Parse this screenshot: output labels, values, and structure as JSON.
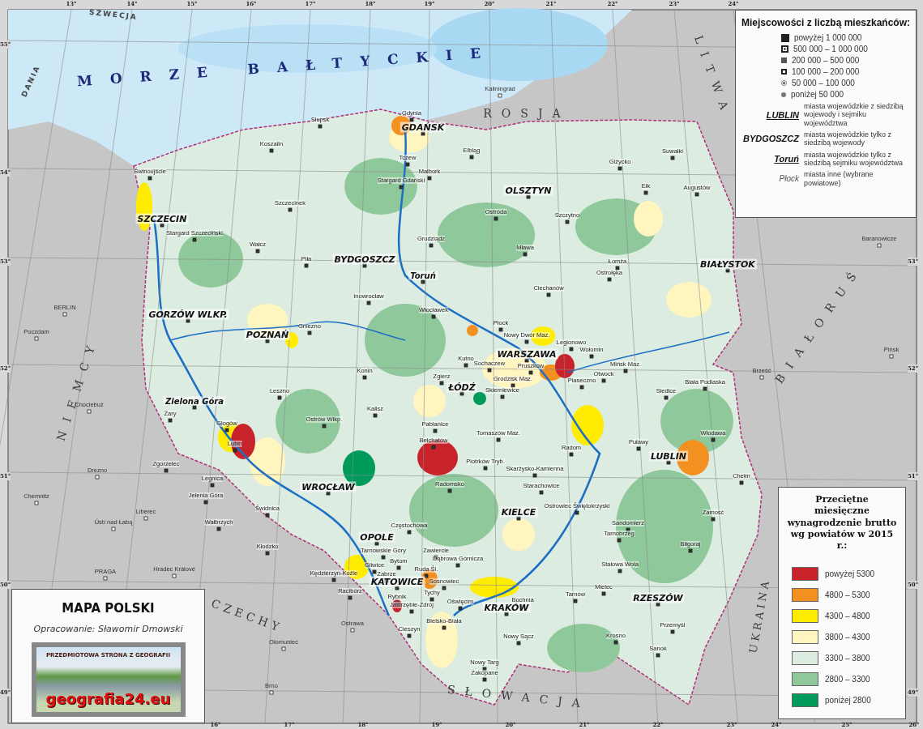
{
  "graticule": {
    "top": [
      "13°",
      "14°",
      "15°",
      "16°",
      "17°",
      "18°",
      "19°",
      "20°",
      "21°",
      "22°",
      "23°",
      "24°"
    ],
    "bottom": [
      "16°",
      "17°",
      "18°",
      "19°",
      "20°",
      "21°",
      "22°",
      "23°",
      "24°",
      "25°",
      "26°"
    ],
    "left": [
      "55°",
      "54°",
      "53°",
      "52°",
      "51°",
      "50°",
      "49°"
    ],
    "right": [
      "53°",
      "52°",
      "51°",
      "50°",
      "49°"
    ]
  },
  "places": [
    {
      "name": "MORZE BAŁTYCKIE",
      "kind": "sea"
    },
    {
      "name": "SZWECJA",
      "kind": "country-small"
    },
    {
      "name": "DANIA",
      "kind": "country-small"
    },
    {
      "name": "ROSJA",
      "kind": "country"
    },
    {
      "name": "LITWA",
      "kind": "country"
    },
    {
      "name": "BIAŁORUŚ",
      "kind": "country"
    },
    {
      "name": "UKRAINA",
      "kind": "country"
    },
    {
      "name": "NIEMCY",
      "kind": "country"
    },
    {
      "name": "CZECHY",
      "kind": "country"
    },
    {
      "name": "SŁOWACJA",
      "kind": "country"
    },
    {
      "name": "GDAŃSK",
      "kind": "capital"
    },
    {
      "name": "OLSZTYN",
      "kind": "capital"
    },
    {
      "name": "SZCZECIN",
      "kind": "capital"
    },
    {
      "name": "BYDGOSZCZ",
      "kind": "capital"
    },
    {
      "name": "BIAŁYSTOK",
      "kind": "capital"
    },
    {
      "name": "Toruń",
      "kind": "capital-sejmik"
    },
    {
      "name": "GORZÓW WLKP.",
      "kind": "capital"
    },
    {
      "name": "POZNAŃ",
      "kind": "capital"
    },
    {
      "name": "WARSZAWA",
      "kind": "capital"
    },
    {
      "name": "ŁÓDŹ",
      "kind": "capital"
    },
    {
      "name": "Zielona Góra",
      "kind": "capital-sejmik"
    },
    {
      "name": "LUBLIN",
      "kind": "capital"
    },
    {
      "name": "WROCŁAW",
      "kind": "capital"
    },
    {
      "name": "KIELCE",
      "kind": "capital"
    },
    {
      "name": "OPOLE",
      "kind": "capital"
    },
    {
      "name": "KATOWICE",
      "kind": "capital"
    },
    {
      "name": "RZESZÓW",
      "kind": "capital"
    },
    {
      "name": "KRAKÓW",
      "kind": "capital"
    },
    {
      "name": "Gdynia",
      "kind": "town"
    },
    {
      "name": "Słupsk",
      "kind": "town"
    },
    {
      "name": "Koszalin",
      "kind": "town"
    },
    {
      "name": "Kaliningrad",
      "kind": "foreign"
    },
    {
      "name": "Elbląg",
      "kind": "town"
    },
    {
      "name": "Tczew",
      "kind": "town"
    },
    {
      "name": "Malbork",
      "kind": "town"
    },
    {
      "name": "Stargard Gdański",
      "kind": "town"
    },
    {
      "name": "Świnoujście",
      "kind": "town"
    },
    {
      "name": "Stargard Szczeciński",
      "kind": "town"
    },
    {
      "name": "Szczecinek",
      "kind": "town"
    },
    {
      "name": "Wałcz",
      "kind": "town"
    },
    {
      "name": "Piła",
      "kind": "town"
    },
    {
      "name": "Grudziądz",
      "kind": "town"
    },
    {
      "name": "Ostróda",
      "kind": "town"
    },
    {
      "name": "Szczytno",
      "kind": "town"
    },
    {
      "name": "Giżycko",
      "kind": "town"
    },
    {
      "name": "Suwałki",
      "kind": "town"
    },
    {
      "name": "Ełk",
      "kind": "town"
    },
    {
      "name": "Augustów",
      "kind": "town"
    },
    {
      "name": "Mława",
      "kind": "town"
    },
    {
      "name": "Łomża",
      "kind": "town"
    },
    {
      "name": "Ostrołęka",
      "kind": "town"
    },
    {
      "name": "Ciechanów",
      "kind": "town"
    },
    {
      "name": "Inowrocław",
      "kind": "town"
    },
    {
      "name": "Gniezno",
      "kind": "town"
    },
    {
      "name": "Włocławek",
      "kind": "town"
    },
    {
      "name": "Płock",
      "kind": "town"
    },
    {
      "name": "Kutno",
      "kind": "town"
    },
    {
      "name": "Nowy Dwór Maz.",
      "kind": "town"
    },
    {
      "name": "Legionowo",
      "kind": "town"
    },
    {
      "name": "Wołomin",
      "kind": "town"
    },
    {
      "name": "Mińsk Maz.",
      "kind": "town"
    },
    {
      "name": "Siedlce",
      "kind": "town"
    },
    {
      "name": "Biała Podlaska",
      "kind": "town"
    },
    {
      "name": "Konin",
      "kind": "town"
    },
    {
      "name": "Leszno",
      "kind": "town"
    },
    {
      "name": "Kalisz",
      "kind": "town"
    },
    {
      "name": "Ostrów Wlkp.",
      "kind": "town"
    },
    {
      "name": "Zgierz",
      "kind": "town"
    },
    {
      "name": "Pabianice",
      "kind": "town"
    },
    {
      "name": "Bełchatów",
      "kind": "town"
    },
    {
      "name": "Sochaczew",
      "kind": "town"
    },
    {
      "name": "Skierniewice",
      "kind": "town"
    },
    {
      "name": "Pruszków",
      "kind": "town"
    },
    {
      "name": "Grodzisk Maz.",
      "kind": "town"
    },
    {
      "name": "Piaseczno",
      "kind": "town"
    },
    {
      "name": "Otwock",
      "kind": "town"
    },
    {
      "name": "Tomaszów Maz.",
      "kind": "town"
    },
    {
      "name": "Piotrków Tryb.",
      "kind": "town"
    },
    {
      "name": "Radom",
      "kind": "town"
    },
    {
      "name": "Puławy",
      "kind": "town"
    },
    {
      "name": "Włodawa",
      "kind": "town"
    },
    {
      "name": "Chełm",
      "kind": "town"
    },
    {
      "name": "Zamość",
      "kind": "town"
    },
    {
      "name": "Radomsko",
      "kind": "town"
    },
    {
      "name": "Częstochowa",
      "kind": "town"
    },
    {
      "name": "Skarżysko-Kamienna",
      "kind": "town"
    },
    {
      "name": "Starachowice",
      "kind": "town"
    },
    {
      "name": "Ostrowiec Świętokrzyski",
      "kind": "town"
    },
    {
      "name": "Sandomierz",
      "kind": "town"
    },
    {
      "name": "Tarnobrzeg",
      "kind": "town"
    },
    {
      "name": "Stalowa Wola",
      "kind": "town"
    },
    {
      "name": "Biłgoraj",
      "kind": "town"
    },
    {
      "name": "Mielec",
      "kind": "town"
    },
    {
      "name": "Tarnów",
      "kind": "town"
    },
    {
      "name": "Bochnia",
      "kind": "town"
    },
    {
      "name": "Nowy Sącz",
      "kind": "town"
    },
    {
      "name": "Nowy Targ",
      "kind": "town"
    },
    {
      "name": "Zakopane",
      "kind": "town"
    },
    {
      "name": "Krosno",
      "kind": "town"
    },
    {
      "name": "Sanok",
      "kind": "town"
    },
    {
      "name": "Przemyśl",
      "kind": "town"
    },
    {
      "name": "Zawiercie",
      "kind": "town"
    },
    {
      "name": "Dąbrowa Górnicza",
      "kind": "town"
    },
    {
      "name": "Sosnowiec",
      "kind": "town"
    },
    {
      "name": "Tarnowskie Góry",
      "kind": "town"
    },
    {
      "name": "Bytom",
      "kind": "town"
    },
    {
      "name": "Gliwice",
      "kind": "town"
    },
    {
      "name": "Zabrze",
      "kind": "town"
    },
    {
      "name": "Ruda Śl.",
      "kind": "town"
    },
    {
      "name": "Tychy",
      "kind": "town"
    },
    {
      "name": "Oświęcim",
      "kind": "town"
    },
    {
      "name": "Rybnik",
      "kind": "town"
    },
    {
      "name": "Jastrzębie-Zdrój",
      "kind": "town"
    },
    {
      "name": "Kędzierzyn-Koźle",
      "kind": "town"
    },
    {
      "name": "Racibórz",
      "kind": "town"
    },
    {
      "name": "Bielsko-Biała",
      "kind": "town"
    },
    {
      "name": "Cieszyn",
      "kind": "town"
    },
    {
      "name": "Żary",
      "kind": "town"
    },
    {
      "name": "Głogów",
      "kind": "town"
    },
    {
      "name": "Lubin",
      "kind": "town"
    },
    {
      "name": "Zgorzelec",
      "kind": "town"
    },
    {
      "name": "Legnica",
      "kind": "town"
    },
    {
      "name": "Jelenia Góra",
      "kind": "town"
    },
    {
      "name": "Świdnica",
      "kind": "town"
    },
    {
      "name": "Wałbrzych",
      "kind": "town"
    },
    {
      "name": "Kłodzko",
      "kind": "town"
    },
    {
      "name": "Baranowicze",
      "kind": "foreign"
    },
    {
      "name": "BERLIN",
      "kind": "foreign"
    },
    {
      "name": "Poczdam",
      "kind": "foreign"
    },
    {
      "name": "Pińsk",
      "kind": "foreign"
    },
    {
      "name": "Brześć",
      "kind": "foreign"
    },
    {
      "name": "Chociebuż",
      "kind": "foreign"
    },
    {
      "name": "Drezno",
      "kind": "foreign"
    },
    {
      "name": "Chemnitz",
      "kind": "foreign"
    },
    {
      "name": "Liberec",
      "kind": "foreign"
    },
    {
      "name": "Ústí nad Łabą",
      "kind": "foreign"
    },
    {
      "name": "Hradec Králové",
      "kind": "foreign"
    },
    {
      "name": "PRAGA",
      "kind": "foreign"
    },
    {
      "name": "Ostrawa",
      "kind": "foreign"
    },
    {
      "name": "Ołomuniec",
      "kind": "foreign"
    },
    {
      "name": "Brno",
      "kind": "foreign"
    }
  ],
  "population_legend": {
    "title": "Miejscowości z liczbą mieszkańców:",
    "sizes": [
      {
        "label": "powyżej 1 000 000",
        "kind": "big-square"
      },
      {
        "label": "500 000 – 1 000 000",
        "kind": "framed-square"
      },
      {
        "label": "200 000 – 500 000",
        "kind": "grey-square"
      },
      {
        "label": "100 000 – 200 000",
        "kind": "open-square"
      },
      {
        "label": "50 000 – 100 000",
        "kind": "ringed-dot"
      },
      {
        "label": "poniżej 50 000",
        "kind": "dot"
      }
    ],
    "styles": [
      {
        "sample": "LUBLIN",
        "kind": "capital-both",
        "description": "miasta wojewódzkie z siedzibą wojewody i sejmiku województwa"
      },
      {
        "sample": "BYDGOSZCZ",
        "kind": "capital-voivode",
        "description": "miasta wojewódzkie tylko z siedzibą wojewody"
      },
      {
        "sample": "Toruń",
        "kind": "capital-sejmik",
        "description": "miasta wojewódzkie tylko z siedzibą sejmiku województwa"
      },
      {
        "sample": "Płock",
        "kind": "town",
        "description": "miasta inne (wybrane powiatowe)"
      }
    ]
  },
  "wage_legend": {
    "title": "Przeciętne miesięczne wynagrodzenie brutto wg powiatów w 2015 r.:",
    "items": [
      {
        "label": "powyżej 5300",
        "color": "#c8232a"
      },
      {
        "label": "4800 – 5300",
        "color": "#f29120"
      },
      {
        "label": "4300 – 4800",
        "color": "#ffec00"
      },
      {
        "label": "3800 – 4300",
        "color": "#fff5bf"
      },
      {
        "label": "3300 – 3800",
        "color": "#dcece0"
      },
      {
        "label": "2800 – 3300",
        "color": "#8fc89a"
      },
      {
        "label": "poniżej 2800",
        "color": "#009a5a"
      }
    ]
  },
  "title_box": {
    "title": "MAPA POLSKI",
    "author": "Opracowanie: Sławomir Dmowski",
    "logo_top": "PRZEDMIOTOWA STRONA Z GEOGRAFII",
    "logo_bottom": "geografia24.eu"
  }
}
